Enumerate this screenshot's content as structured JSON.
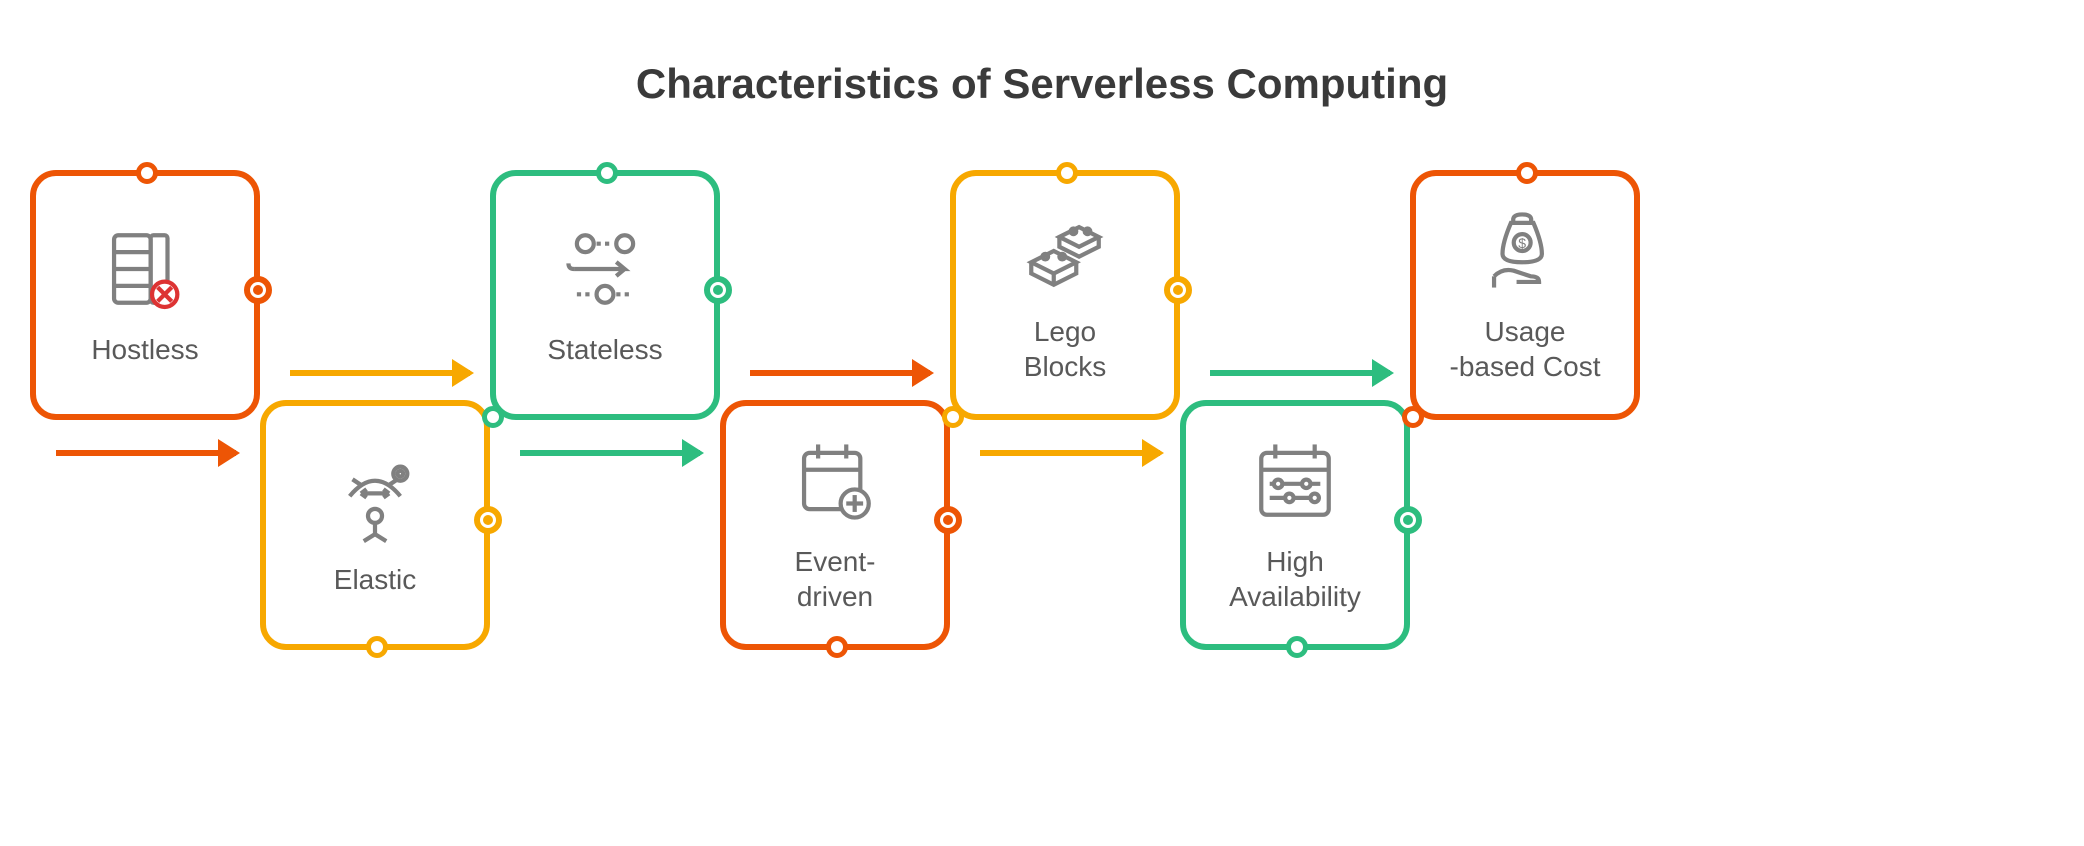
{
  "title": "Characteristics of Serverless Computing",
  "steps": [
    {
      "label": "Hostless",
      "color": "orange",
      "icon": "server-x"
    },
    {
      "label": "Elastic",
      "color": "yellow",
      "icon": "flex-person"
    },
    {
      "label": "Stateless",
      "color": "green",
      "icon": "gears-flow"
    },
    {
      "label": "Event-\ndriven",
      "color": "orange",
      "icon": "calendar-plus"
    },
    {
      "label": "Lego\nBlocks",
      "color": "yellow",
      "icon": "blocks"
    },
    {
      "label": "High\nAvailability",
      "color": "green",
      "icon": "schedule"
    },
    {
      "label": "Usage\n-based Cost",
      "color": "orange",
      "icon": "money-hand"
    }
  ]
}
